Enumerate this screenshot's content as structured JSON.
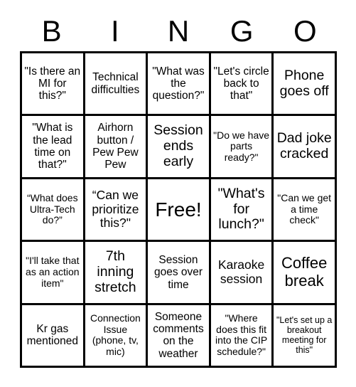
{
  "card": {
    "title": "BINGO",
    "header_letters": [
      "B",
      "I",
      "N",
      "G",
      "O"
    ],
    "columns": 5,
    "rows": 5,
    "colors": {
      "background": "#ffffff",
      "grid_line": "#000000",
      "text": "#000000"
    },
    "cells": [
      {
        "text": "\"Is there an MI for this?\"",
        "size": "fs-md",
        "free": false
      },
      {
        "text": "Technical difficulties",
        "size": "fs-md",
        "free": false
      },
      {
        "text": "\"What was the question?\"",
        "size": "fs-md",
        "free": false
      },
      {
        "text": "\"Let's circle back to that\"",
        "size": "fs-md",
        "free": false
      },
      {
        "text": "Phone goes off",
        "size": "fs-xl",
        "free": false
      },
      {
        "text": "\"What is the lead time on that?\"",
        "size": "fs-md",
        "free": false
      },
      {
        "text": "Airhorn button / Pew Pew Pew",
        "size": "fs-md",
        "free": false
      },
      {
        "text": "Session ends early",
        "size": "fs-xl",
        "free": false
      },
      {
        "text": "\"Do we have parts ready?\"",
        "size": "fs-sm",
        "free": false
      },
      {
        "text": "Dad joke cracked",
        "size": "fs-xl",
        "free": false
      },
      {
        "text": "“What does Ultra-Tech do?”",
        "size": "fs-sm",
        "free": false
      },
      {
        "text": "“Can we prioritize this?\"",
        "size": "fs-lg",
        "free": false
      },
      {
        "text": "Free!",
        "size": "fs-free",
        "free": true
      },
      {
        "text": "\"What's for lunch?\"",
        "size": "fs-xl",
        "free": false
      },
      {
        "text": "\"Can we get a time check\"",
        "size": "fs-sm",
        "free": false
      },
      {
        "text": "\"I'll take that as an action item\"",
        "size": "fs-sm",
        "free": false
      },
      {
        "text": "7th inning stretch",
        "size": "fs-xl",
        "free": false
      },
      {
        "text": "Session goes over time",
        "size": "fs-md",
        "free": false
      },
      {
        "text": "Karaoke session",
        "size": "fs-lg",
        "free": false
      },
      {
        "text": "Coffee break",
        "size": "fs-xxl",
        "free": false
      },
      {
        "text": "Kr gas mentioned",
        "size": "fs-md",
        "free": false
      },
      {
        "text": "Connection Issue (phone, tv, mic)",
        "size": "fs-sm",
        "free": false
      },
      {
        "text": "Someone comments on the weather",
        "size": "fs-md",
        "free": false
      },
      {
        "text": "\"Where does this fit into the CIP schedule?\"",
        "size": "fs-sm",
        "free": false
      },
      {
        "text": "\"Let's set up a breakout meeting for this\"",
        "size": "fs-xs",
        "free": false
      }
    ]
  }
}
